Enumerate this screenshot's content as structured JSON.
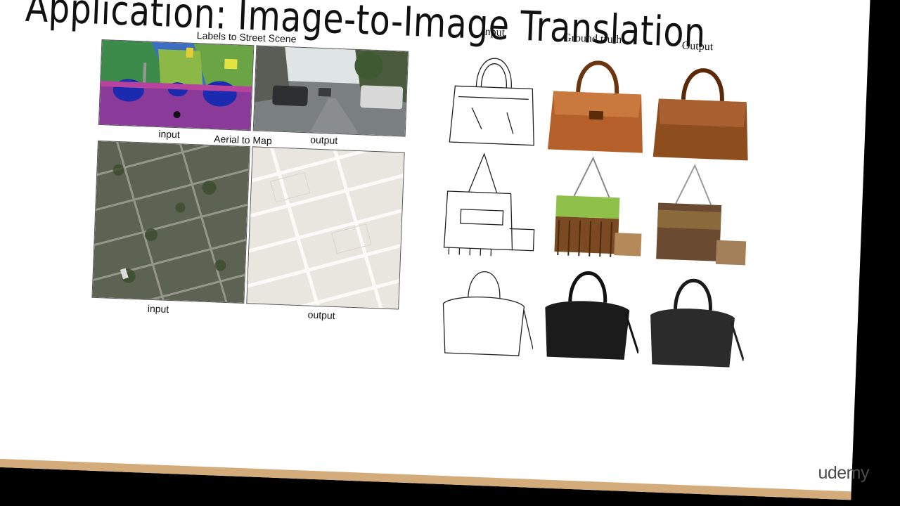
{
  "slide": {
    "title": "Application: Image-to-Image Translation",
    "accent_color": "#d4ac7c"
  },
  "left_figure": {
    "street": {
      "title": "Labels to Street Scene",
      "input_label": "input",
      "output_label": "output"
    },
    "aerial": {
      "title": "Aerial to Map",
      "input_label": "input",
      "output_label": "output"
    }
  },
  "right_figure": {
    "col_input": "Input",
    "col_ground_truth": "Ground truth",
    "col_output": "Output",
    "rows": [
      "brown-handbag",
      "green-fringe-handbag",
      "black-handbag"
    ]
  },
  "watermark": {
    "brand": "udemy"
  }
}
